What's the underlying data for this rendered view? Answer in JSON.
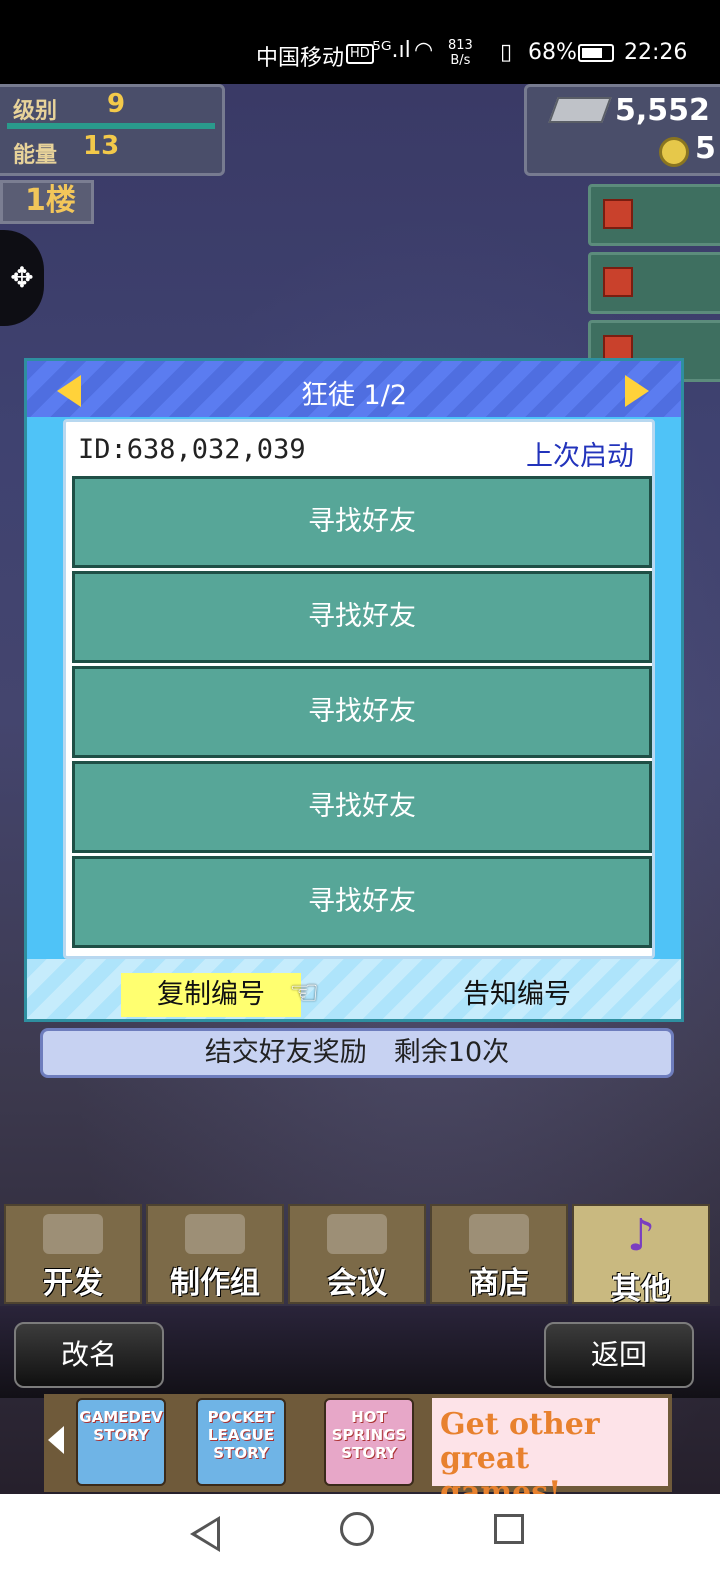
{
  "status_bar": {
    "carrier": "中国移动",
    "hd": "HD",
    "signal": "⁵ᴳ.ıl",
    "wifi": "◠",
    "speed_value": "813",
    "speed_unit": "B/s",
    "vibrate": "▯",
    "battery_percent": "68%",
    "time": "22:26"
  },
  "hud": {
    "level_label": "级别",
    "level_value": "9",
    "energy_label": "能量",
    "energy_value": "13",
    "floor_label": "1楼",
    "money": "5,552",
    "coins": "5"
  },
  "dialog": {
    "title": "狂徒 1/2",
    "id_text": "ID:638,032,039",
    "last_start_label": "上次启动",
    "friend_rows": [
      "寻找好友",
      "寻找好友",
      "寻找好友",
      "寻找好友",
      "寻找好友"
    ],
    "copy_button": "复制编号",
    "notify_button": "告知编号",
    "reward_text": "结交好友奖励　剩余10次"
  },
  "menu": {
    "tabs": [
      {
        "label": "开发"
      },
      {
        "label": "制作组"
      },
      {
        "label": "会议"
      },
      {
        "label": "商店"
      },
      {
        "label": "其他",
        "icon": "♪"
      }
    ],
    "rename_button": "改名",
    "back_button": "返回"
  },
  "ad": {
    "games": [
      "GAMEDEV STORY",
      "POCKET LEAGUE STORY",
      "HOT SPRINGS STORY"
    ],
    "cta": "Get other great games!"
  },
  "colors": {
    "dialog_bg": "#4fc3f7",
    "row_bg": "#57a698",
    "copy_highlight": "#ffff70",
    "link_blue": "#2233bb"
  }
}
